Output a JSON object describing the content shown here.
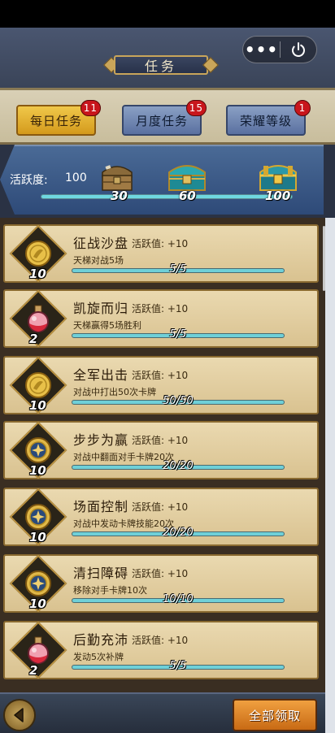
{
  "header": {
    "title": "任务",
    "capsule_more": "•••"
  },
  "tabs": [
    {
      "label": "每日任务",
      "badge": "11",
      "active": true
    },
    {
      "label": "月度任务",
      "badge": "15",
      "active": false
    },
    {
      "label": "荣耀等级",
      "badge": "1",
      "active": false
    }
  ],
  "activity": {
    "label": "活跃度:",
    "value": "100",
    "progress": 1.0,
    "milestones": [
      {
        "value": "30",
        "icon": "wooden-chest-icon"
      },
      {
        "value": "60",
        "icon": "teal-chest-icon"
      },
      {
        "value": "100",
        "icon": "golden-chest-icon"
      }
    ]
  },
  "tasks": [
    {
      "name": "征战沙盘",
      "activity": "活跃值: +10",
      "desc": "天梯对战5场",
      "progress_text": "5/5",
      "progress": 1.0,
      "reward": "10",
      "icon": "gold-coin-icon"
    },
    {
      "name": "凯旋而归",
      "activity": "活跃值: +10",
      "desc": "天梯赢得5场胜利",
      "progress_text": "5/5",
      "progress": 1.0,
      "reward": "2",
      "icon": "potion-icon"
    },
    {
      "name": "全军出击",
      "activity": "活跃值: +10",
      "desc": "对战中打出50次卡牌",
      "progress_text": "50/50",
      "progress": 1.0,
      "reward": "10",
      "icon": "gold-coin-icon"
    },
    {
      "name": "步步为赢",
      "activity": "活跃值: +10",
      "desc": "对战中翻面对手卡牌20次",
      "progress_text": "20/20",
      "progress": 1.0,
      "reward": "10",
      "icon": "star-medal-icon"
    },
    {
      "name": "场面控制",
      "activity": "活跃值: +10",
      "desc": "对战中发动卡牌技能20次",
      "progress_text": "20/20",
      "progress": 1.0,
      "reward": "10",
      "icon": "star-medal-icon"
    },
    {
      "name": "清扫障碍",
      "activity": "活跃值: +10",
      "desc": "移除对手卡牌10次",
      "progress_text": "10/10",
      "progress": 1.0,
      "reward": "10",
      "icon": "star-medal-icon"
    },
    {
      "name": "后勤充沛",
      "activity": "活跃值: +10",
      "desc": "发动5次补牌",
      "progress_text": "5/5",
      "progress": 1.0,
      "reward": "2",
      "icon": "potion-icon"
    }
  ],
  "footer": {
    "claim_all_label": "全部领取",
    "back_icon": "back-arrow-icon"
  }
}
